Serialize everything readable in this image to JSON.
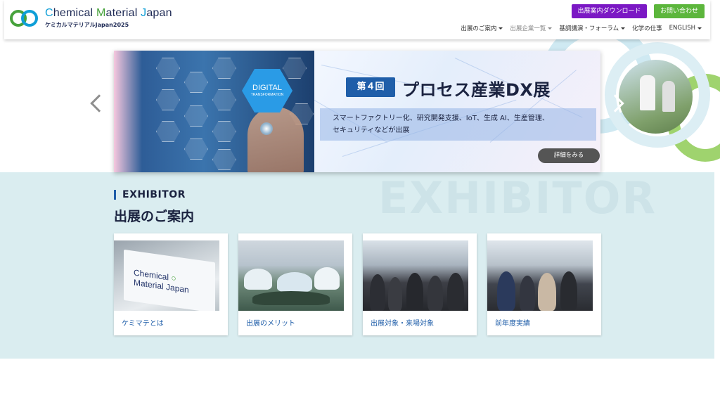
{
  "header": {
    "logo_title_prefix_c": "C",
    "logo_title_part1": "hemical ",
    "logo_title_m": "M",
    "logo_title_part2": "aterial ",
    "logo_title_j": "J",
    "logo_title_part3": "apan",
    "logo_subtitle": "ケミカルマテリアルJapan2025",
    "download_button": "出展案内ダウンロード",
    "contact_button": "お問い合わせ",
    "nav": [
      {
        "label": "出展のご案内"
      },
      {
        "label": "出展企業一覧"
      },
      {
        "label": "基調講演・フォーラム"
      },
      {
        "label": "化学の仕事"
      },
      {
        "label": "ENGLISH"
      }
    ],
    "colors": {
      "download": "#7b18c4",
      "contact": "#5cb63c"
    }
  },
  "hero": {
    "hex_text": "DIGITAL",
    "hex_subtext": "TRANSFORMATION",
    "badge": "第４回",
    "title": "プロセス産業DX展",
    "description_line1": "スマートファクトリー化、研究開発支援、IoT、生成 AI、生産管理、",
    "description_line2": "セキュリティなどが出展",
    "more_button": "詳細をみる"
  },
  "exhibitor": {
    "background_word": "EXHIBITOR",
    "label": "EXHIBITOR",
    "title": "出展のご案内",
    "sign_line1": "Chemical",
    "sign_line2": "Material Japan",
    "cards": [
      {
        "label": "ケミマテとは"
      },
      {
        "label": "出展のメリット"
      },
      {
        "label": "出展対象・来場対象"
      },
      {
        "label": "前年度実績"
      }
    ]
  },
  "icons": [
    "logo-rings-icon",
    "chevron-left-icon",
    "chevron-right-icon",
    "caret-down-icon"
  ]
}
